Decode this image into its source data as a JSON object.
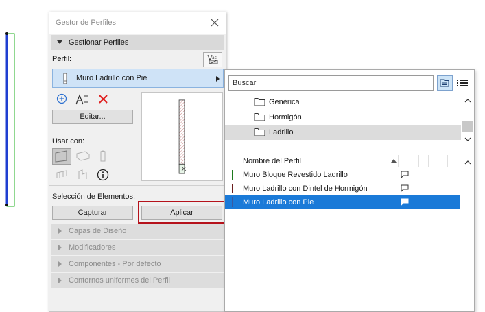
{
  "palette": {
    "title": "Gestor de Perfiles",
    "section_title": "Gestionar Perfiles",
    "perfil_label": "Perfil:",
    "selected_profile": "Muro Ladrillo con Pie",
    "edit_button": "Editar...",
    "usar_label": "Usar con:",
    "seleccion_label": "Selección de Elementos:",
    "capturar_button": "Capturar",
    "aplicar_button": "Aplicar",
    "collapsed_sections": [
      "Capas de Diseño",
      "Modificadores",
      "Componentes - Por defecto",
      "Contornos uniformes del Perfil"
    ]
  },
  "popup": {
    "search_placeholder": "Buscar",
    "folders": [
      "Genérica",
      "Hormigón",
      "Ladrillo"
    ],
    "selected_folder": "Ladrillo",
    "list_header": "Nombre del Perfil",
    "profiles": [
      {
        "name": "Muro Bloque Revestido Ladrillo",
        "color": "#1e7a1e"
      },
      {
        "name": "Muro Ladrillo con Dintel de Hormigón",
        "color": "#6a1e1e"
      },
      {
        "name": "Muro Ladrillo con Pie",
        "color": "#3a5aa0"
      }
    ],
    "selected_profile_index": 2
  },
  "colors": {
    "accent": "#1a7ad8",
    "highlight_border": "#b5121b",
    "wall_stroke": "#1f3fd1",
    "wall_hatch": "#22b022"
  }
}
